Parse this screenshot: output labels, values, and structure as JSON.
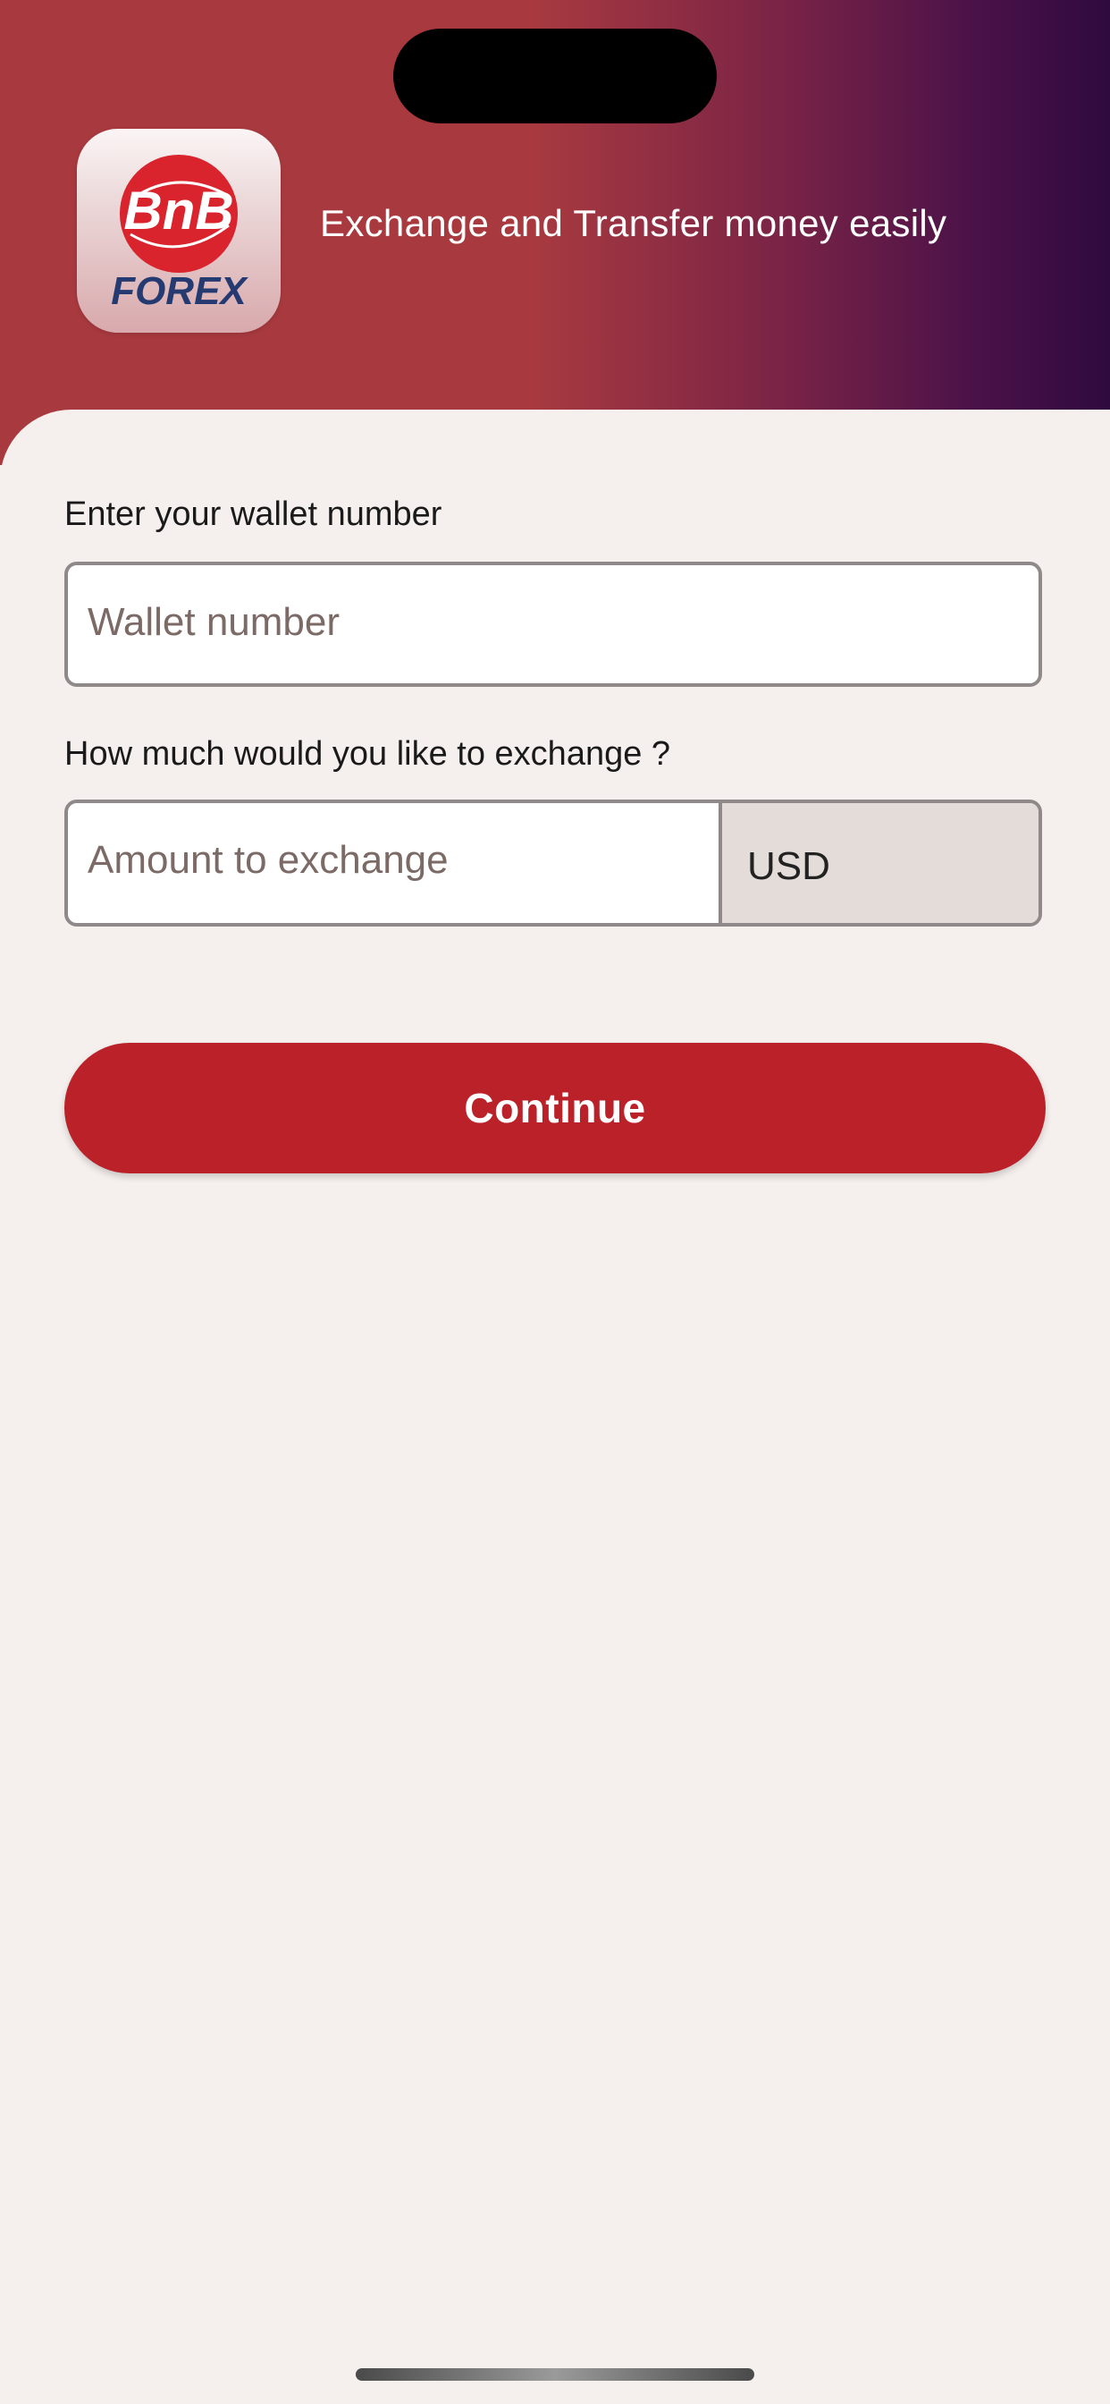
{
  "header": {
    "tagline": "Exchange and Transfer money easily",
    "logo": {
      "top_text": "BnB",
      "bottom_text": "FOREX",
      "icon": "bnb-forex-logo-icon",
      "colors": {
        "red": "#d9232d",
        "navy": "#263a72"
      }
    },
    "gradient_colors": [
      "#a83a3f",
      "#7b2446",
      "#2f0a3f"
    ]
  },
  "wallet": {
    "label": "Enter your wallet number",
    "placeholder": "Wallet number",
    "value": ""
  },
  "amount": {
    "label": "How much would you like to exchange ?",
    "placeholder": "Amount to exchange",
    "value": "",
    "currency": "USD"
  },
  "actions": {
    "continue_label": "Continue",
    "accent_color": "#bb2129"
  }
}
